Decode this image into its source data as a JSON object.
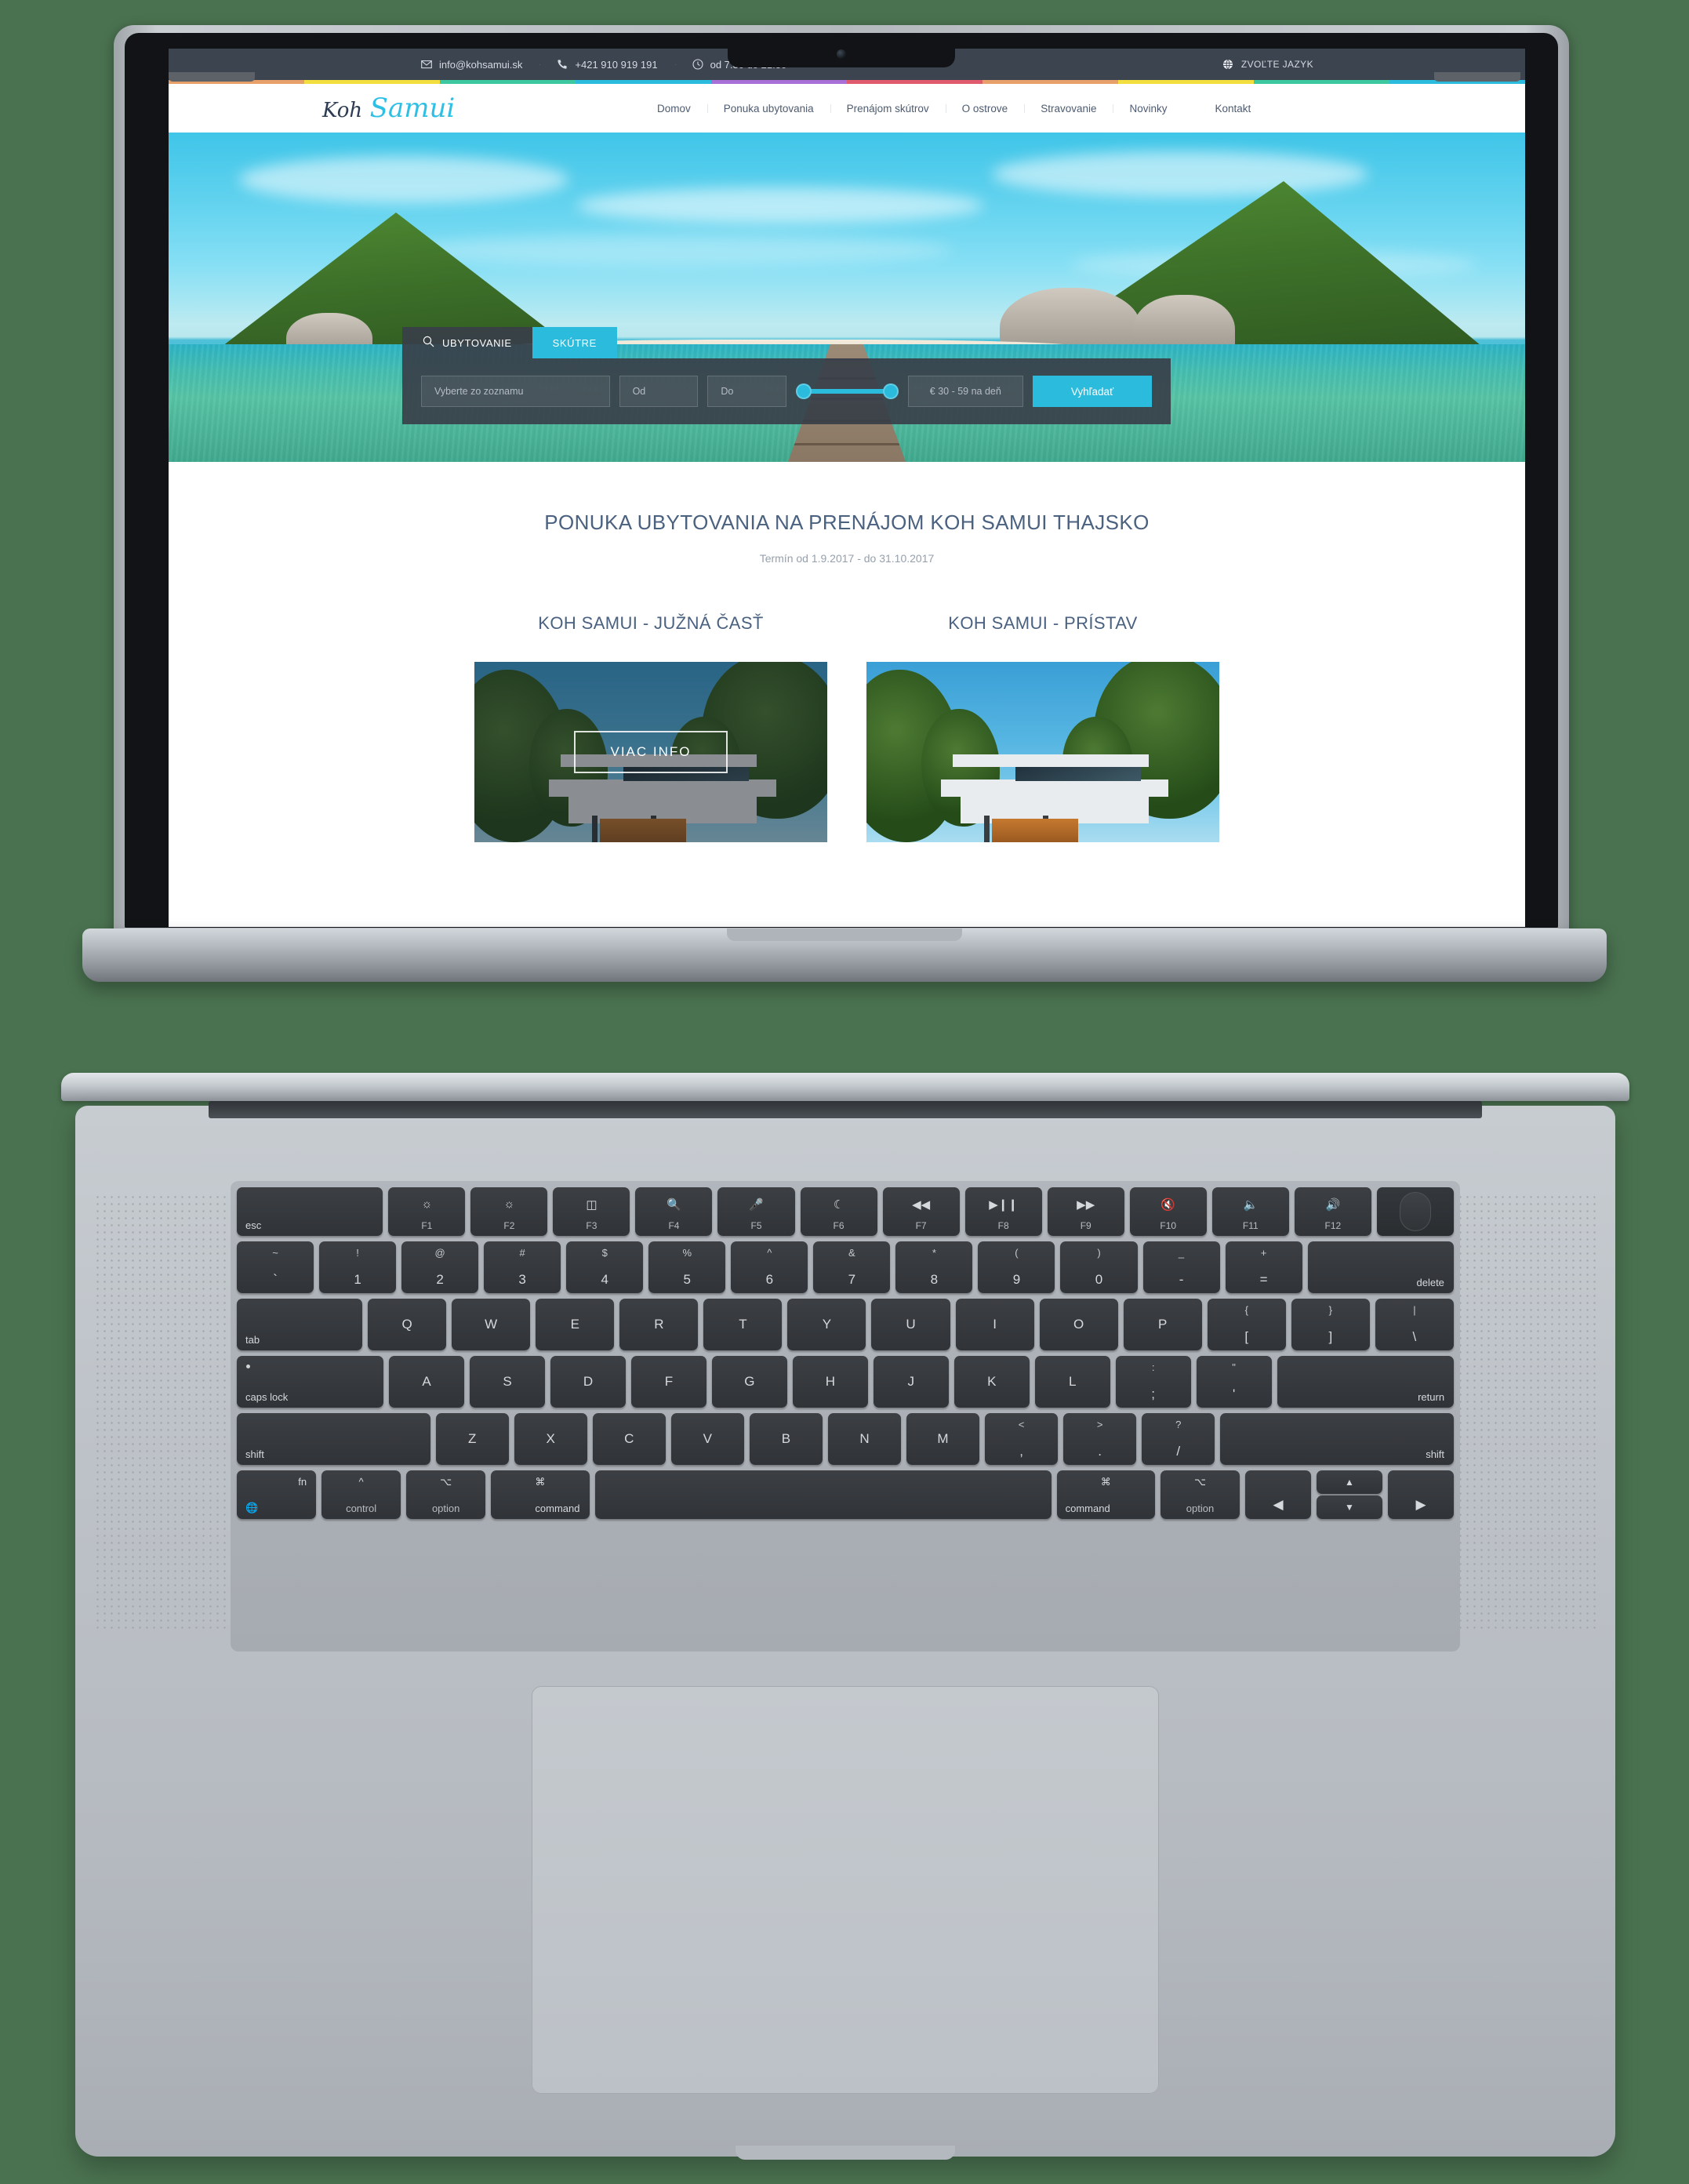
{
  "site": {
    "topbar": {
      "email": "info@kohsamui.sk",
      "phone": "+421 910 919 191",
      "hours": "od 7:30 do 21:30",
      "language": "ZVOĽTE JAZYK",
      "email_icon": "envelope-icon",
      "phone_icon": "phone-icon",
      "clock_icon": "clock-icon",
      "globe_icon": "globe-icon"
    },
    "logo": {
      "part1": "Koh",
      "part2": "Samui"
    },
    "menu": [
      {
        "label": "Domov"
      },
      {
        "label": "Ponuka ubytovania"
      },
      {
        "label": "Prenájom skútrov"
      },
      {
        "label": "O ostrove"
      },
      {
        "label": "Stravovanie"
      },
      {
        "label": "Novinky"
      },
      {
        "label": "Kontakt"
      }
    ],
    "search_widget": {
      "search_icon": "search-icon",
      "tab_accommodation": "UBYTOVANIE",
      "tab_scooters": "SKÚTRE",
      "select_placeholder": "Vyberte zo zoznamu",
      "date_from": "Od",
      "date_to": "Do",
      "price_range": "€ 30 - 59 na deň",
      "submit": "Vyhľadať"
    },
    "main": {
      "heading": "PONUKA UBYTOVANIA NA PRENÁJOM KOH SAMUI THAJSKO",
      "subheading": "Termín od 1.9.2017 - do 31.10.2017",
      "cards": [
        {
          "title": "KOH SAMUI - JUŽNÁ ČASŤ",
          "cta": "VIAC INFO"
        },
        {
          "title": "KOH SAMUI - PRÍSTAV",
          "cta": ""
        }
      ]
    },
    "colors": {
      "accent": "#2bbbdd",
      "heading": "#4a6180",
      "topbar_bg": "#3c4450",
      "page_bg": "#4a7250"
    }
  },
  "keyboard": {
    "function_row": [
      {
        "label": "esc",
        "glyph": "",
        "style": "wide-left"
      },
      {
        "label": "F1",
        "glyph": "brightness-low-icon"
      },
      {
        "label": "F2",
        "glyph": "brightness-high-icon"
      },
      {
        "label": "F3",
        "glyph": "mission-control-icon"
      },
      {
        "label": "F4",
        "glyph": "spotlight-search-icon"
      },
      {
        "label": "F5",
        "glyph": "dictation-mic-icon"
      },
      {
        "label": "F6",
        "glyph": "do-not-disturb-moon-icon"
      },
      {
        "label": "F7",
        "glyph": "rewind-icon"
      },
      {
        "label": "F8",
        "glyph": "play-pause-icon"
      },
      {
        "label": "F9",
        "glyph": "fast-forward-icon"
      },
      {
        "label": "F10",
        "glyph": "mute-icon"
      },
      {
        "label": "F11",
        "glyph": "volume-down-icon"
      },
      {
        "label": "F12",
        "glyph": "volume-up-icon"
      },
      {
        "label": "",
        "glyph": "touch-id-icon",
        "style": "touchid"
      }
    ],
    "number_row": [
      {
        "top": "~",
        "bottom": "`"
      },
      {
        "top": "!",
        "bottom": "1"
      },
      {
        "top": "@",
        "bottom": "2"
      },
      {
        "top": "#",
        "bottom": "3"
      },
      {
        "top": "$",
        "bottom": "4"
      },
      {
        "top": "%",
        "bottom": "5"
      },
      {
        "top": "^",
        "bottom": "6"
      },
      {
        "top": "&",
        "bottom": "7"
      },
      {
        "top": "*",
        "bottom": "8"
      },
      {
        "top": "(",
        "bottom": "9"
      },
      {
        "top": ")",
        "bottom": "0"
      },
      {
        "top": "_",
        "bottom": "-"
      },
      {
        "top": "+",
        "bottom": "="
      },
      {
        "label": "delete",
        "style": "wide-right"
      }
    ],
    "qwerty_row": [
      {
        "label": "tab",
        "style": "wide-left"
      },
      {
        "label": "Q"
      },
      {
        "label": "W"
      },
      {
        "label": "E"
      },
      {
        "label": "R"
      },
      {
        "label": "T"
      },
      {
        "label": "Y"
      },
      {
        "label": "U"
      },
      {
        "label": "I"
      },
      {
        "label": "O"
      },
      {
        "label": "P"
      },
      {
        "top": "{",
        "bottom": "["
      },
      {
        "top": "}",
        "bottom": "]"
      },
      {
        "top": "|",
        "bottom": "\\"
      }
    ],
    "home_row": [
      {
        "label": "caps lock",
        "style": "caps"
      },
      {
        "label": "A"
      },
      {
        "label": "S"
      },
      {
        "label": "D"
      },
      {
        "label": "F"
      },
      {
        "label": "G"
      },
      {
        "label": "H"
      },
      {
        "label": "J"
      },
      {
        "label": "K"
      },
      {
        "label": "L"
      },
      {
        "top": ":",
        "bottom": ";"
      },
      {
        "top": "\"",
        "bottom": "'"
      },
      {
        "label": "return",
        "style": "wide-right"
      }
    ],
    "bottom_row": [
      {
        "label": "shift",
        "style": "wide-left"
      },
      {
        "label": "Z"
      },
      {
        "label": "X"
      },
      {
        "label": "C"
      },
      {
        "label": "V"
      },
      {
        "label": "B"
      },
      {
        "label": "N"
      },
      {
        "label": "M"
      },
      {
        "top": "<",
        "bottom": ","
      },
      {
        "top": ">",
        "bottom": "."
      },
      {
        "top": "?",
        "bottom": "/"
      },
      {
        "label": "shift",
        "style": "wide-right"
      }
    ],
    "modifier_row": [
      {
        "label": "fn",
        "sub": "globe-icon",
        "style": "fn"
      },
      {
        "label": "control",
        "sub": "^"
      },
      {
        "label": "option",
        "sub": "⌥"
      },
      {
        "label": "command",
        "sub": "⌘"
      },
      {
        "label": "",
        "style": "space"
      },
      {
        "label": "command",
        "sub": "⌘"
      },
      {
        "label": "option",
        "sub": "⌥"
      }
    ],
    "arrow_keys": {
      "left": "◀",
      "up": "▲",
      "down": "▼",
      "right": "▶"
    }
  }
}
